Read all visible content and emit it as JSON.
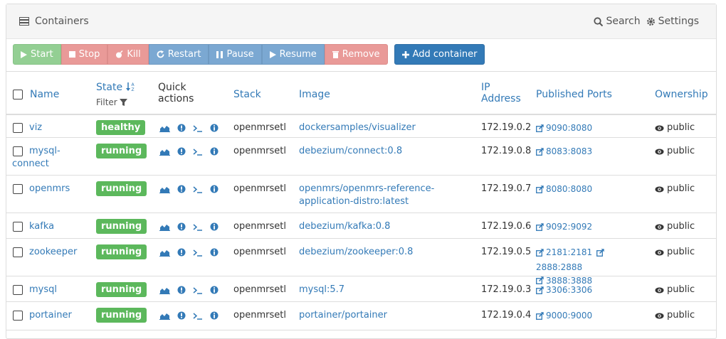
{
  "header": {
    "title": "Containers",
    "search_label": "Search",
    "settings_label": "Settings"
  },
  "toolbar": {
    "start": "Start",
    "stop": "Stop",
    "kill": "Kill",
    "restart": "Restart",
    "pause": "Pause",
    "resume": "Resume",
    "remove": "Remove",
    "add": "Add container"
  },
  "columns": {
    "name": "Name",
    "state": "State",
    "filter": "Filter",
    "quick": "Quick",
    "actions": "actions",
    "stack": "Stack",
    "image": "Image",
    "ip1": "IP",
    "ip2": "Address",
    "ports": "Published Ports",
    "ownership": "Ownership"
  },
  "rows": [
    {
      "name_l1": "viz",
      "name_l2": "",
      "state": "healthy",
      "stack": "openmrsetl",
      "image_l1": "dockersamples/visualizer",
      "image_l2": "",
      "ip": "172.19.0.2",
      "ports": [
        "9090:8080"
      ],
      "ownership": "public"
    },
    {
      "name_l1": "mysql-",
      "name_l2": "connect",
      "state": "running",
      "stack": "openmrsetl",
      "image_l1": "debezium/connect:0.8",
      "image_l2": "",
      "ip": "172.19.0.8",
      "ports": [
        "8083:8083"
      ],
      "ownership": "public"
    },
    {
      "name_l1": "openmrs",
      "name_l2": "",
      "state": "running",
      "stack": "openmrsetl",
      "image_l1": "openmrs/openmrs-reference-",
      "image_l2": "application-distro:latest",
      "ip": "172.19.0.7",
      "ports": [
        "8080:8080"
      ],
      "ownership": "public"
    },
    {
      "name_l1": "kafka",
      "name_l2": "",
      "state": "running",
      "stack": "openmrsetl",
      "image_l1": "debezium/kafka:0.8",
      "image_l2": "",
      "ip": "172.19.0.6",
      "ports": [
        "9092:9092"
      ],
      "ownership": "public"
    },
    {
      "name_l1": "zookeeper",
      "name_l2": "",
      "state": "running",
      "stack": "openmrsetl",
      "image_l1": "debezium/zookeeper:0.8",
      "image_l2": "",
      "ip": "172.19.0.5",
      "ports": [
        "2181:2181",
        "2888:2888",
        "3888:3888"
      ],
      "ownership": "public"
    },
    {
      "name_l1": "mysql",
      "name_l2": "",
      "state": "running",
      "stack": "openmrsetl",
      "image_l1": "mysql:5.7",
      "image_l2": "",
      "ip": "172.19.0.3",
      "ports": [
        "3306:3306"
      ],
      "ownership": "public"
    },
    {
      "name_l1": "portainer",
      "name_l2": "",
      "state": "running",
      "stack": "openmrsetl",
      "image_l1": "portainer/portainer",
      "image_l2": "",
      "ip": "172.19.0.4",
      "ports": [
        "9000:9000"
      ],
      "ownership": "public"
    }
  ],
  "colors": {
    "healthy": "#5cb85c",
    "running": "#5cb85c",
    "link": "#337ab7"
  }
}
